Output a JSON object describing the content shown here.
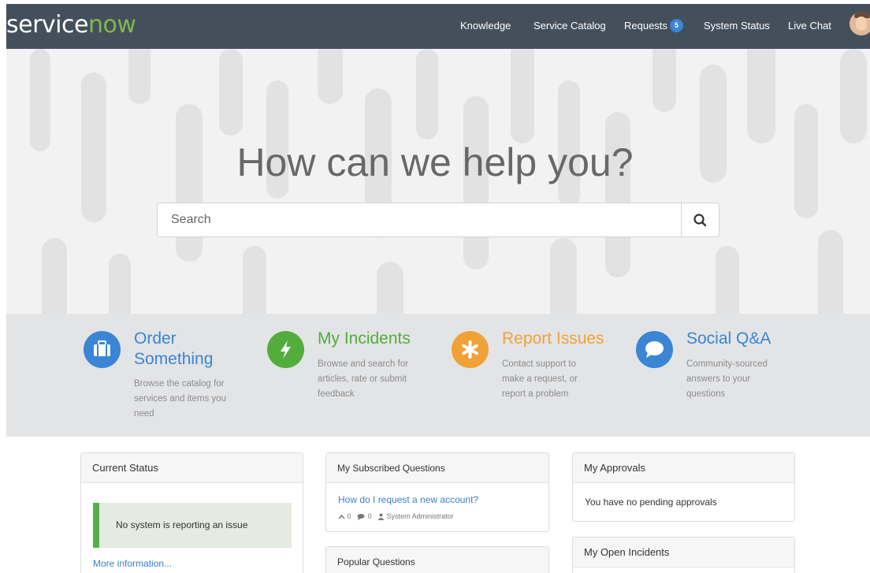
{
  "header": {
    "logo_part1": "service",
    "logo_part2": "now",
    "nav": {
      "knowledge": "Knowledge",
      "service_catalog": "Service Catalog",
      "requests": "Requests",
      "requests_count": "5",
      "system_status": "System Status",
      "live_chat": "Live Chat"
    }
  },
  "hero": {
    "title": "How can we help you?",
    "search_placeholder": "Search"
  },
  "shortcuts": [
    {
      "title_line1": "Order",
      "title_line2": "Something",
      "desc_line1": "Browse the catalog for",
      "desc_line2": "services and items you",
      "desc_line3": "need",
      "color": "#3a85d4",
      "icon": "briefcase-icon"
    },
    {
      "title_line1": "My Incidents",
      "desc_line1": "Browse and search for",
      "desc_line2": "articles, rate or submit",
      "desc_line3": "feedback",
      "color": "#52ad3d",
      "icon": "lightning-icon"
    },
    {
      "title_line1": "Report Issues",
      "desc_line1": "Contact support to",
      "desc_line2": "make a request, or",
      "desc_line3": "report a problem",
      "color": "#f0a238",
      "icon": "asterisk-icon"
    },
    {
      "title_line1": "Social Q&A",
      "desc_line1": "Community-sourced",
      "desc_line2": "answers to your",
      "desc_line3": "questions",
      "color": "#3a85d4",
      "icon": "chat-bubble-icon"
    }
  ],
  "current_status": {
    "title": "Current Status",
    "message": "No system is reporting an issue",
    "more_link": "More information..."
  },
  "subscribed_questions": {
    "title": "My Subscribed Questions",
    "question": "How do I request a new account?",
    "votes": "0",
    "answers": "0",
    "author": "System Administrator"
  },
  "popular_questions": {
    "title": "Popular Questions"
  },
  "approvals": {
    "title": "My Approvals",
    "message": "You have no pending approvals"
  },
  "open_incidents": {
    "title": "My Open Incidents"
  },
  "colors": {
    "header_bg": "#43505b",
    "logo_accent": "#80b84c",
    "link": "#3a7fcf",
    "status_ok": "#56b04a"
  }
}
